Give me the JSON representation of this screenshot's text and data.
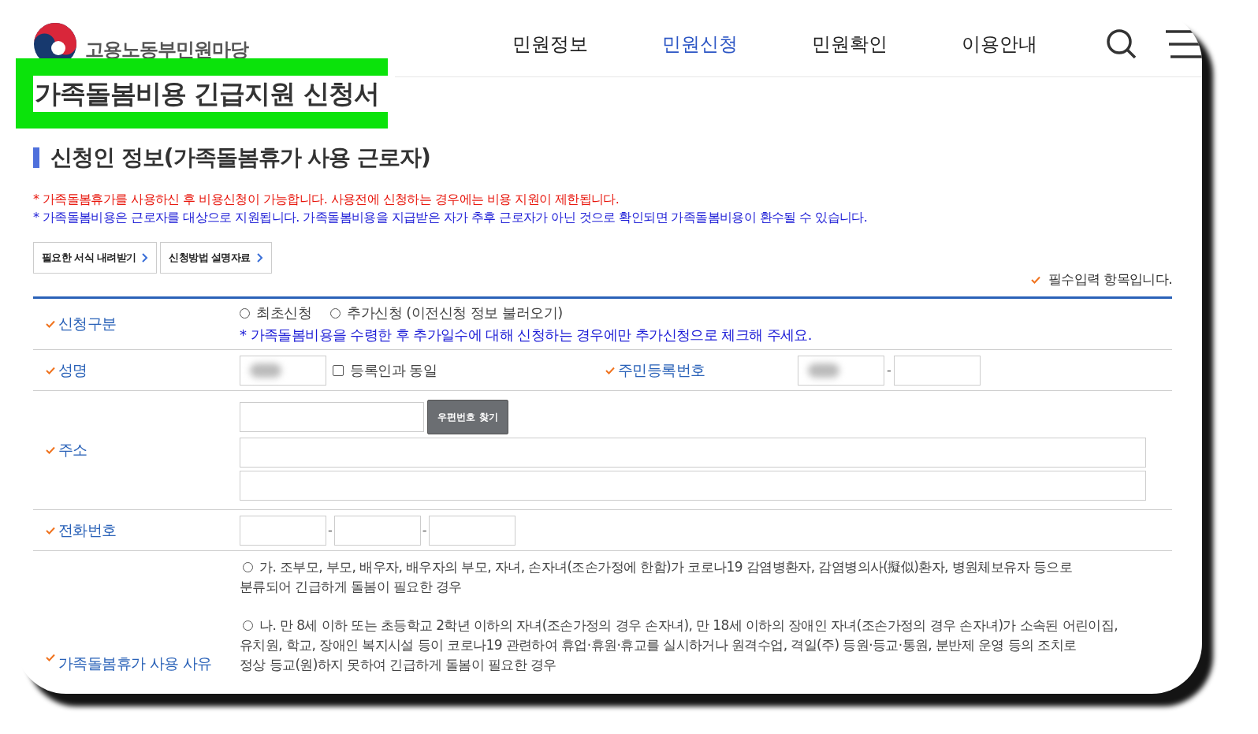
{
  "site": {
    "name": "고용노동부민원마당"
  },
  "nav": [
    {
      "label": "민원정보",
      "selected": false
    },
    {
      "label": "민원신청",
      "selected": true
    },
    {
      "label": "민원확인",
      "selected": false
    },
    {
      "label": "이용안내",
      "selected": false
    }
  ],
  "page_title": "가족돌봄비용 긴급지원 신청서",
  "section_title": "신청인 정보(가족돌봄휴가 사용 근로자)",
  "notices": [
    {
      "text": "* 가족돌봄휴가를 사용하신 후 비용신청이 가능합니다. 사용전에 신청하는 경우에는 비용 지원이 제한됩니다.",
      "color": "#e8160c"
    },
    {
      "text": "* 가족돌봄비용은 근로자를 대상으로 지원됩니다. 가족돌봄비용을 지급받은 자가 추후 근로자가 아닌 것으로 확인되면 가족돌봄비용이 환수될 수 있습니다.",
      "color": "#1c1cd6"
    }
  ],
  "link_buttons": [
    "필요한 서식 내려받기",
    "신청방법 설명자료"
  ],
  "required_note": "필수입력 항목입니다.",
  "form": [
    {
      "kind": "choice",
      "label": "신청구분",
      "options": [
        {
          "label": "최초신청",
          "selected": false
        },
        {
          "label": "추가신청 (이전신청 정보 불러오기)",
          "selected": false
        }
      ],
      "note": "* 가족돌봄비용을 수령한 후 추가일수에 대해 신청하는 경우에만 추가신청으로 체크해 주세요."
    },
    {
      "kind": "name",
      "label": "성명",
      "name_field": {
        "redacted": true
      },
      "same_checkbox": {
        "label": "등록인과 동일",
        "checked": false
      },
      "id_label": "주민등록번호",
      "id_fields": [
        {
          "redacted": true
        },
        {
          "redacted": false
        }
      ],
      "separator": "-"
    },
    {
      "kind": "address",
      "label": "주소",
      "zip_button": "우편번호 찾기"
    },
    {
      "kind": "phone",
      "label": "전화번호",
      "separators": [
        "-",
        "-"
      ]
    },
    {
      "kind": "reason",
      "label": "가족돌봄휴가 사용 사유",
      "options": [
        {
          "selected": false,
          "lines": [
            "가. 조부모, 부모, 배우자, 배우자의 부모, 자녀, 손자녀(조손가정에 한함)가 코로나19 감염병환자, 감염병의사(擬似)환자, 병원체보유자 등으로",
            "분류되어 긴급하게 돌봄이 필요한 경우"
          ]
        },
        {
          "selected": false,
          "lines": [
            "나. 만 8세 이하 또는 초등학교 2학년 이하의 자녀(조손가정의 경우 손자녀), 만 18세 이하의 장애인 자녀(조손가정의 경우 손자녀)가 소속된 어린이집,",
            "유치원, 학교, 장애인 복지시설 등이 코로나19 관련하여 휴업·휴원·휴교를 실시하거나 원격수업, 격일(주) 등원·등교·통원, 분반제 운영 등의 조치로",
            "정상 등교(원)하지 못하여 긴급하게 돌봄이 필요한 경우"
          ]
        }
      ]
    }
  ]
}
